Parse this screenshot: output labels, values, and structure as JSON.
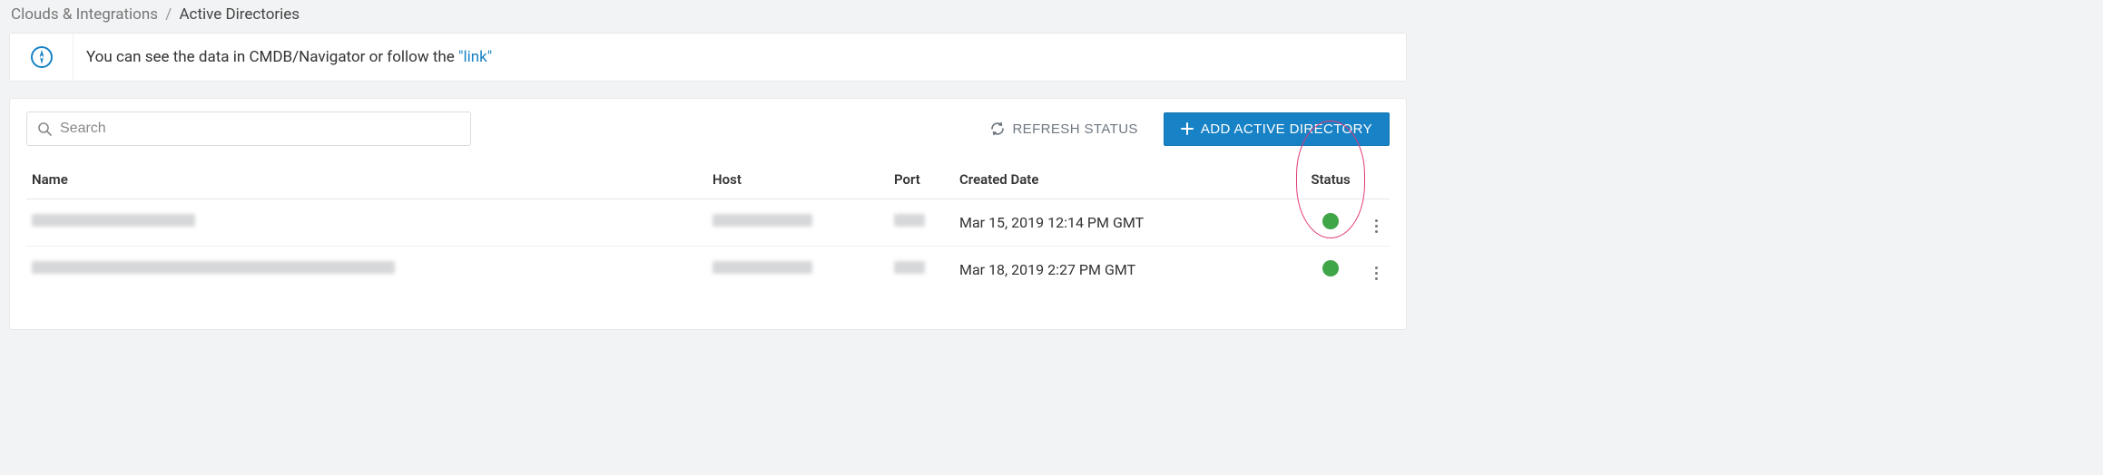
{
  "breadcrumb": {
    "parent": "Clouds & Integrations",
    "separator": "/",
    "current": "Active Directories"
  },
  "banner": {
    "text_before_link": "You can see the data in CMDB/Navigator or follow the ",
    "link_text": "\"link\""
  },
  "search": {
    "placeholder": "Search"
  },
  "buttons": {
    "refresh": "REFRESH STATUS",
    "add": "ADD ACTIVE DIRECTORY"
  },
  "table": {
    "headers": {
      "name": "Name",
      "host": "Host",
      "port": "Port",
      "created": "Created Date",
      "status": "Status"
    },
    "rows": [
      {
        "name_blur_class": "w1",
        "host_blur_class": "wh",
        "port_blur_class": "wp",
        "created": "Mar 15, 2019 12:14 PM GMT",
        "status_color": "#3fa648"
      },
      {
        "name_blur_class": "w2",
        "host_blur_class": "wh",
        "port_blur_class": "wp",
        "created": "Mar 18, 2019 2:27 PM GMT",
        "status_color": "#3fa648"
      }
    ]
  },
  "colors": {
    "accent": "#1782c5",
    "status_ok": "#3fa648",
    "highlight_ring": "#e23a7a"
  }
}
